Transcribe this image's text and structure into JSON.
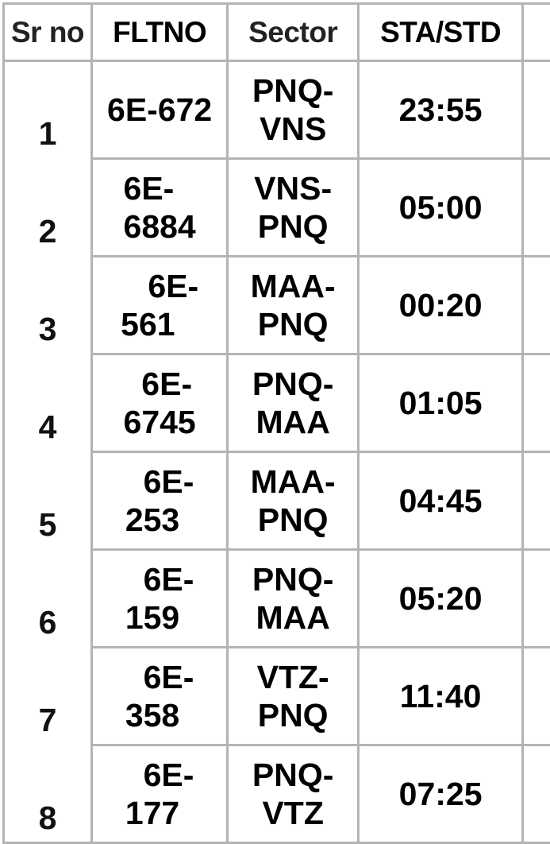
{
  "table": {
    "headers": {
      "sr_no": "Sr no",
      "fltno": "FLTNO",
      "sector": "Sector",
      "sta_std": "STA/STD",
      "extra": ""
    },
    "rows": [
      {
        "sr_no": "1",
        "fltno": "6E-672",
        "fltno_display": "6E-672",
        "sector": "PNQ-VNS",
        "sector_display": "PNQ-\nVNS",
        "sta_std": "23:55"
      },
      {
        "sr_no": "2",
        "fltno": "6E-6884",
        "fltno_display": "6E-\n6884",
        "sector": "VNS-PNQ",
        "sector_display": "VNS-\nPNQ",
        "sta_std": "05:00"
      },
      {
        "sr_no": "3",
        "fltno": "6E-561",
        "fltno_display": "   6E-\n561",
        "sector": "MAA-PNQ",
        "sector_display": "MAA-\nPNQ",
        "sta_std": "00:20"
      },
      {
        "sr_no": "4",
        "fltno": "6E-6745",
        "fltno_display": "  6E-\n6745",
        "sector": "PNQ-MAA",
        "sector_display": "PNQ-\nMAA",
        "sta_std": "01:05"
      },
      {
        "sr_no": "5",
        "fltno": "6E-253",
        "fltno_display": "  6E-\n253",
        "sector": "MAA-PNQ",
        "sector_display": "MAA-\nPNQ",
        "sta_std": "04:45"
      },
      {
        "sr_no": "6",
        "fltno": "6E-159",
        "fltno_display": "  6E-\n159",
        "sector": "PNQ-MAA",
        "sector_display": "PNQ-\nMAA",
        "sta_std": "05:20"
      },
      {
        "sr_no": "7",
        "fltno": "6E-358",
        "fltno_display": "  6E-\n358",
        "sector": "VTZ-PNQ",
        "sector_display": "VTZ-\nPNQ",
        "sta_std": "11:40"
      },
      {
        "sr_no": "8",
        "fltno": "6E-177",
        "fltno_display": "  6E-\n177",
        "sector": "PNQ-VTZ",
        "sector_display": "PNQ-\nVTZ",
        "sta_std": "07:25"
      }
    ]
  },
  "colors": {
    "border": "#b4b4b4",
    "text": "#000000",
    "header_soft_text": "#222222",
    "background": "#ffffff"
  }
}
